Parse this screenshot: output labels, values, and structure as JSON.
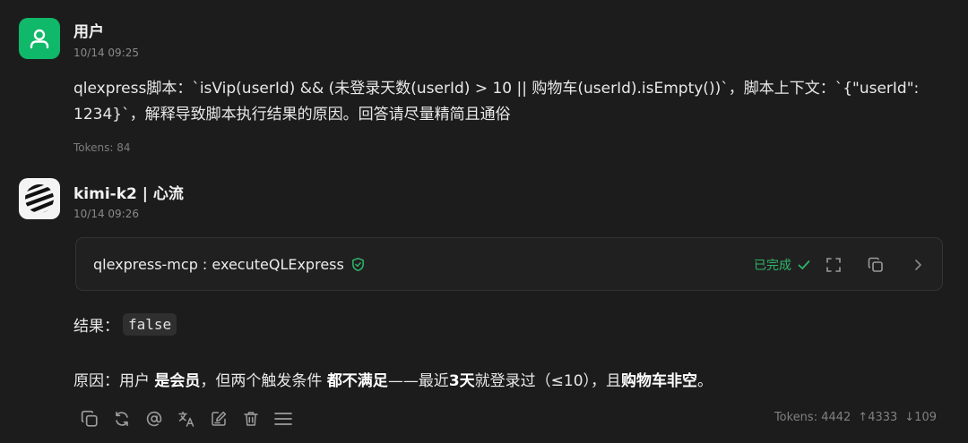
{
  "user_message": {
    "author": "用户",
    "time": "10/14 09:25",
    "lines": [
      "qlexpress脚本：`isVip(userId) && (未登录天数(userId) > 10 || 购物车(userId).isEmpty())`，脚本上下文：`{\"userId\":",
      "1234}`，解释导致脚本执行结果的原因。回答请尽量精简且通俗"
    ],
    "tokens": "Tokens: 84",
    "avatar_color": "#10b869"
  },
  "assistant_message": {
    "author": "kimi-k2 | 心流",
    "time": "10/14 09:26",
    "tool_call": {
      "name": "qlexpress-mcp : executeQLExpress",
      "status": "已完成",
      "status_color": "#2fb46a"
    },
    "result_label": "结果：",
    "result_value": "false",
    "reason": {
      "prefix": "原因：用户 ",
      "bold1": "是会员",
      "mid1": "，但两个触发条件 ",
      "bold2": "都不满足",
      "mid2": "——最近",
      "bold3": "3天",
      "mid3": "就登录过（≤10），且",
      "bold4": "购物车非空",
      "suffix": "。"
    },
    "token_stats": {
      "total": "Tokens: 4442",
      "up": "↑4333",
      "down": "↓109"
    }
  },
  "icons": {
    "user_avatar": "person-icon",
    "bot_avatar": "kimi-logo-icon",
    "verified": "shield-check-icon",
    "check": "check-icon",
    "expand": "fullscreen-icon",
    "copy": "copy-icon",
    "chevron": "chevron-right-icon",
    "actions": [
      "copy-icon",
      "refresh-icon",
      "at-icon",
      "translate-icon",
      "edit-icon",
      "trash-icon",
      "menu-icon"
    ]
  }
}
